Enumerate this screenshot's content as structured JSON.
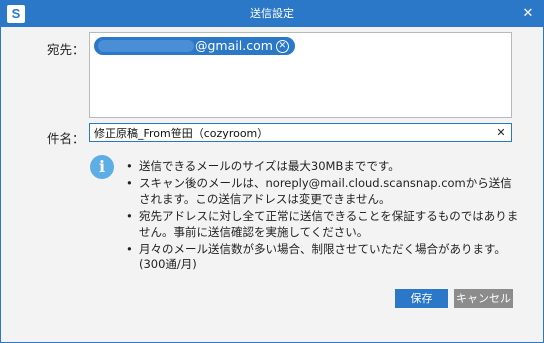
{
  "window": {
    "title": "送信設定",
    "logo_letter": "S",
    "close_glyph": "✕"
  },
  "form": {
    "to_label": "宛先：",
    "recipients": [
      {
        "visible_domain": "@gmail.com",
        "masked": true
      }
    ],
    "chip_remove_glyph": "✕",
    "subject_label": "件名：",
    "subject_value": "修正原稿_From笹田（cozyroom）",
    "clear_glyph": "✕"
  },
  "info": {
    "icon_glyph": "i",
    "notes": [
      "送信できるメールのサイズは最大30MBまでです。",
      "スキャン後のメールは、noreply@mail.cloud.scansnap.comから送信されます。この送信アドレスは変更できません。",
      "宛先アドレスに対し全て正常に送信できることを保証するものではありません。事前に送信確認を実施してください。",
      "月々のメール送信数が多い場合、制限させていただく場合があります。"
    ],
    "note_extra": "(300通/月)"
  },
  "buttons": {
    "save": "保存",
    "cancel": "キャンセル"
  },
  "colors": {
    "accent": "#2b78c8",
    "cancel_gray": "#8c8c8c",
    "info_blue": "#5eaee6"
  }
}
